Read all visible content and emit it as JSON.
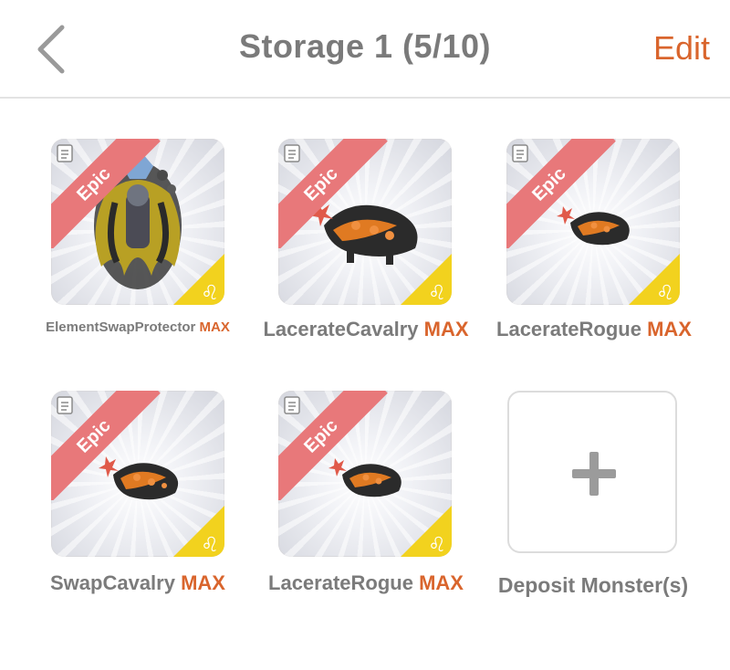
{
  "header": {
    "title": "Storage 1 (5/10)",
    "edit_label": "Edit",
    "back_icon": "chevron-left-icon"
  },
  "colors": {
    "accent": "#d9652d",
    "rarity_ribbon": "#e8787a",
    "badge": "#f2d21e",
    "text_gray": "#7b7b7b"
  },
  "monsters": [
    {
      "name": "ElementSwapProtector",
      "level": "MAX",
      "rarity": "Epic",
      "element_icon": "leo-icon"
    },
    {
      "name": "LacerateCavalry",
      "level": "MAX",
      "rarity": "Epic",
      "element_icon": "leo-icon"
    },
    {
      "name": "LacerateRogue",
      "level": "MAX",
      "rarity": "Epic",
      "element_icon": "leo-icon"
    },
    {
      "name": "SwapCavalry",
      "level": "MAX",
      "rarity": "Epic",
      "element_icon": "leo-icon"
    },
    {
      "name": "LacerateRogue",
      "level": "MAX",
      "rarity": "Epic",
      "element_icon": "leo-icon"
    }
  ],
  "deposit": {
    "label": "Deposit Monster(s)",
    "icon": "plus-icon"
  }
}
